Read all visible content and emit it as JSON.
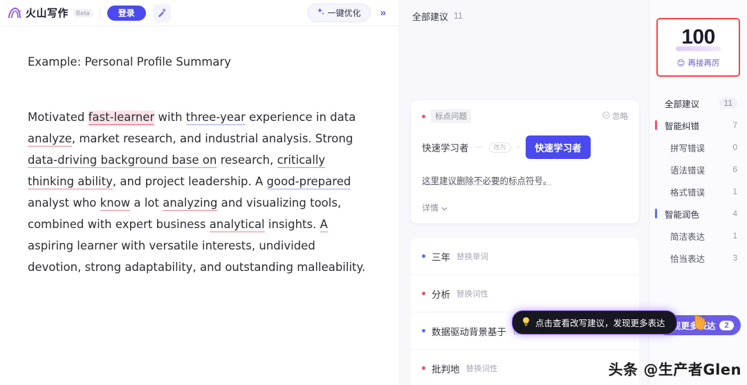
{
  "header": {
    "brand": "火山写作",
    "beta": "Beta",
    "login_label": "登录",
    "wand_icon": "magic-wand-icon",
    "optimize_label": "一键优化",
    "optimize_icon": "sparkle-icon",
    "collapse_icon": "double-chevron-right-icon"
  },
  "document": {
    "title": "Example: Personal Profile Summary",
    "segments": [
      {
        "text": "Motivated ",
        "mark": "none"
      },
      {
        "text": "fast-learner",
        "mark": "red-highlight"
      },
      {
        "text": " with ",
        "mark": "none"
      },
      {
        "text": "three-year",
        "mark": "blue"
      },
      {
        "text": " experience in data ",
        "mark": "none"
      },
      {
        "text": "analyze",
        "mark": "red"
      },
      {
        "text": ", market research, and industrial analysis. Strong ",
        "mark": "none"
      },
      {
        "text": "data-driving background base on",
        "mark": "blue"
      },
      {
        "text": " research, ",
        "mark": "none"
      },
      {
        "text": "critically thinking ability",
        "mark": "red"
      },
      {
        "text": ", and project leadership. A ",
        "mark": "none"
      },
      {
        "text": "good-prepared",
        "mark": "blue"
      },
      {
        "text": " analyst who ",
        "mark": "none"
      },
      {
        "text": "know",
        "mark": "red"
      },
      {
        "text": " a lot ",
        "mark": "none"
      },
      {
        "text": "analyzing",
        "mark": "red"
      },
      {
        "text": " and visualizing tools, combined with expert business ",
        "mark": "none"
      },
      {
        "text": "analytical",
        "mark": "red"
      },
      {
        "text": " insights. ",
        "mark": "none"
      },
      {
        "text": "A",
        "mark": "red"
      },
      {
        "text": " aspiring learner with versatile interests, undivided devotion, strong adaptability, and outstanding malleability.",
        "mark": "none"
      }
    ]
  },
  "suggestions": {
    "header_label": "全部建议",
    "header_count": "11",
    "card": {
      "tag": "标点问题",
      "dot_color": "red",
      "ignore_label": "忽略",
      "ignore_icon": "minus-circle-icon",
      "original": "快速学习者",
      "change_pill": "改为",
      "replacement": "快速学习者",
      "description": "这里建议删除不必要的标点符号。",
      "more_label": "详情",
      "more_icon": "chevron-down-icon"
    },
    "items": [
      {
        "word": "三年",
        "kind": "替换单词",
        "dot": "blue"
      },
      {
        "word": "分析",
        "kind": "替换词性",
        "dot": "red"
      },
      {
        "word": "数据驱动背景基于",
        "kind": "替换单词",
        "dot": "blue"
      },
      {
        "word": "批判地",
        "kind": "替换词性",
        "dot": "red"
      }
    ]
  },
  "tooltip": {
    "icon": "lightbulb-icon",
    "text": "点击查看改写建议，发现更多表达"
  },
  "sidebar": {
    "score": "100",
    "score_sub": "再接再厉",
    "score_emoji": "smile-emoji",
    "categories": [
      {
        "label": "全部建议",
        "count": "11",
        "bar": "none",
        "level": "top",
        "pill": true
      },
      {
        "label": "智能纠错",
        "count": "7",
        "bar": "red",
        "level": "top",
        "pill": false
      },
      {
        "label": "拼写错误",
        "count": "0",
        "bar": "none",
        "level": "sub",
        "pill": false
      },
      {
        "label": "语法错误",
        "count": "6",
        "bar": "none",
        "level": "sub",
        "pill": false
      },
      {
        "label": "格式错误",
        "count": "1",
        "bar": "none",
        "level": "sub",
        "pill": false
      },
      {
        "label": "智能润色",
        "count": "4",
        "bar": "blue",
        "level": "top",
        "pill": false
      },
      {
        "label": "简洁表达",
        "count": "1",
        "bar": "none",
        "level": "sub",
        "pill": false
      },
      {
        "label": "恰当表达",
        "count": "3",
        "bar": "none",
        "level": "sub",
        "pill": false
      }
    ],
    "more_button": "发现更多表达",
    "more_badge": "2",
    "cursor_icon": "hand-cursor-icon"
  },
  "watermark": "头条 @生产者Glen",
  "colors": {
    "accent_blue": "#4a4af0",
    "accent_purple": "#6b5ce7",
    "error_red": "#ef4f66",
    "score_border": "#f4453f",
    "panel_bg": "#f7f7fc"
  }
}
